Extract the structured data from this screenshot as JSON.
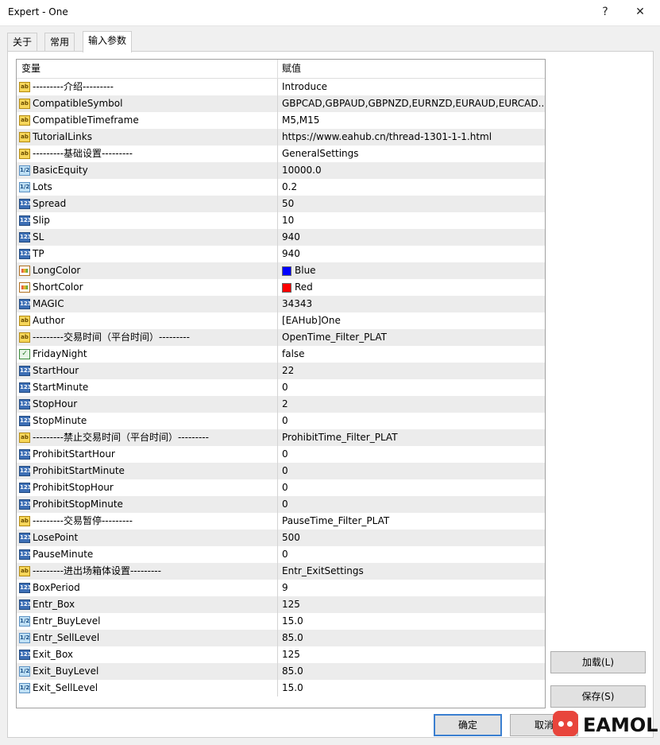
{
  "window": {
    "title": "Expert - One",
    "help_glyph": "?",
    "close_glyph": "✕"
  },
  "tabs": [
    "关于",
    "常用",
    "输入参数"
  ],
  "grid": {
    "header": {
      "variable": "变量",
      "value": "赋值"
    },
    "rows": [
      {
        "name": "---------介绍---------",
        "value": "Introduce",
        "type": "string"
      },
      {
        "name": "CompatibleSymbol",
        "value": "GBPCAD,GBPAUD,GBPNZD,EURNZD,EURAUD,EURCAD...",
        "type": "string"
      },
      {
        "name": "CompatibleTimeframe",
        "value": "M5,M15",
        "type": "string"
      },
      {
        "name": "TutorialLinks",
        "value": "https://www.eahub.cn/thread-1301-1-1.html",
        "type": "string"
      },
      {
        "name": "---------基础设置---------",
        "value": "GeneralSettings",
        "type": "string"
      },
      {
        "name": "BasicEquity",
        "value": "10000.0",
        "type": "double"
      },
      {
        "name": "Lots",
        "value": "0.2",
        "type": "double"
      },
      {
        "name": "Spread",
        "value": "50",
        "type": "int"
      },
      {
        "name": "Slip",
        "value": "10",
        "type": "int"
      },
      {
        "name": "SL",
        "value": "940",
        "type": "int"
      },
      {
        "name": "TP",
        "value": "940",
        "type": "int"
      },
      {
        "name": "LongColor",
        "value": "Blue",
        "type": "color",
        "color": "#0000ff"
      },
      {
        "name": "ShortColor",
        "value": "Red",
        "type": "color",
        "color": "#ff0000"
      },
      {
        "name": "MAGIC",
        "value": "34343",
        "type": "int"
      },
      {
        "name": "Author",
        "value": "[EAHub]One",
        "type": "string"
      },
      {
        "name": "---------交易时间（平台时间）---------",
        "value": "OpenTime_Filter_PLAT",
        "type": "string"
      },
      {
        "name": "FridayNight",
        "value": "false",
        "type": "bool"
      },
      {
        "name": "StartHour",
        "value": "22",
        "type": "int"
      },
      {
        "name": "StartMinute",
        "value": "0",
        "type": "int"
      },
      {
        "name": "StopHour",
        "value": "2",
        "type": "int"
      },
      {
        "name": "StopMinute",
        "value": "0",
        "type": "int"
      },
      {
        "name": "---------禁止交易时间（平台时间）---------",
        "value": "ProhibitTime_Filter_PLAT",
        "type": "string"
      },
      {
        "name": "ProhibitStartHour",
        "value": "0",
        "type": "int"
      },
      {
        "name": "ProhibitStartMinute",
        "value": "0",
        "type": "int"
      },
      {
        "name": "ProhibitStopHour",
        "value": "0",
        "type": "int"
      },
      {
        "name": "ProhibitStopMinute",
        "value": "0",
        "type": "int"
      },
      {
        "name": "---------交易暂停---------",
        "value": "PauseTime_Filter_PLAT",
        "type": "string"
      },
      {
        "name": "LosePoint",
        "value": "500",
        "type": "int"
      },
      {
        "name": "PauseMinute",
        "value": "0",
        "type": "int"
      },
      {
        "name": "---------进出场箱体设置---------",
        "value": "Entr_ExitSettings",
        "type": "string"
      },
      {
        "name": "BoxPeriod",
        "value": "9",
        "type": "int"
      },
      {
        "name": "Entr_Box",
        "value": "125",
        "type": "int"
      },
      {
        "name": "Entr_BuyLevel",
        "value": "15.0",
        "type": "double"
      },
      {
        "name": "Entr_SellLevel",
        "value": "85.0",
        "type": "double"
      },
      {
        "name": "Exit_Box",
        "value": "125",
        "type": "int"
      },
      {
        "name": "Exit_BuyLevel",
        "value": "85.0",
        "type": "double"
      },
      {
        "name": "Exit_SellLevel",
        "value": "15.0",
        "type": "double"
      }
    ]
  },
  "icon_glyphs": {
    "string": "ab",
    "int": "123",
    "double": "1/2",
    "bool": "✓",
    "color": ""
  },
  "buttons": {
    "load": "加载(L)",
    "save": "保存(S)",
    "ok": "确定",
    "cancel": "取消"
  },
  "watermark": {
    "text": "EAMOL"
  }
}
